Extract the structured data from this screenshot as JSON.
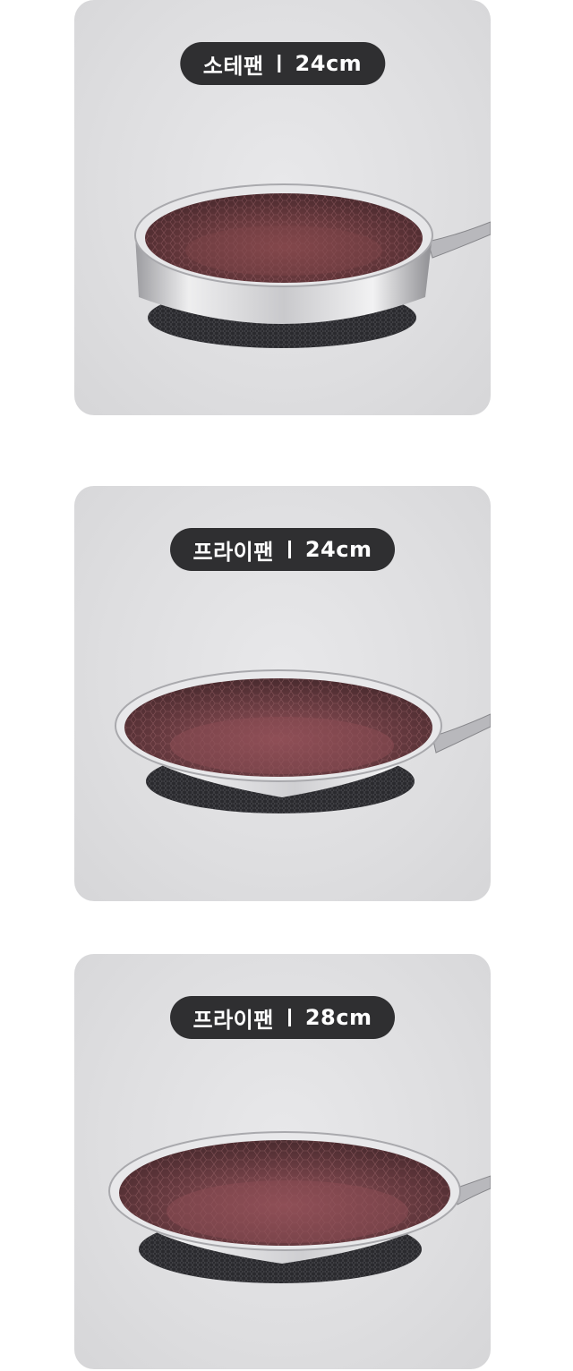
{
  "products": [
    {
      "name": "소테팬",
      "size": "24cm",
      "colors": {
        "coating": "#6b3a3e",
        "steel": "#d7d7d9",
        "base": "#2a2a2e"
      }
    },
    {
      "name": "프라이팬",
      "size": "24cm",
      "colors": {
        "coating": "#6b3a3e",
        "steel": "#d7d7d9",
        "base": "#2a2a2e"
      }
    },
    {
      "name": "프라이팬",
      "size": "28cm",
      "colors": {
        "coating": "#6b3a3e",
        "steel": "#d7d7d9",
        "base": "#2a2a2e"
      }
    }
  ]
}
